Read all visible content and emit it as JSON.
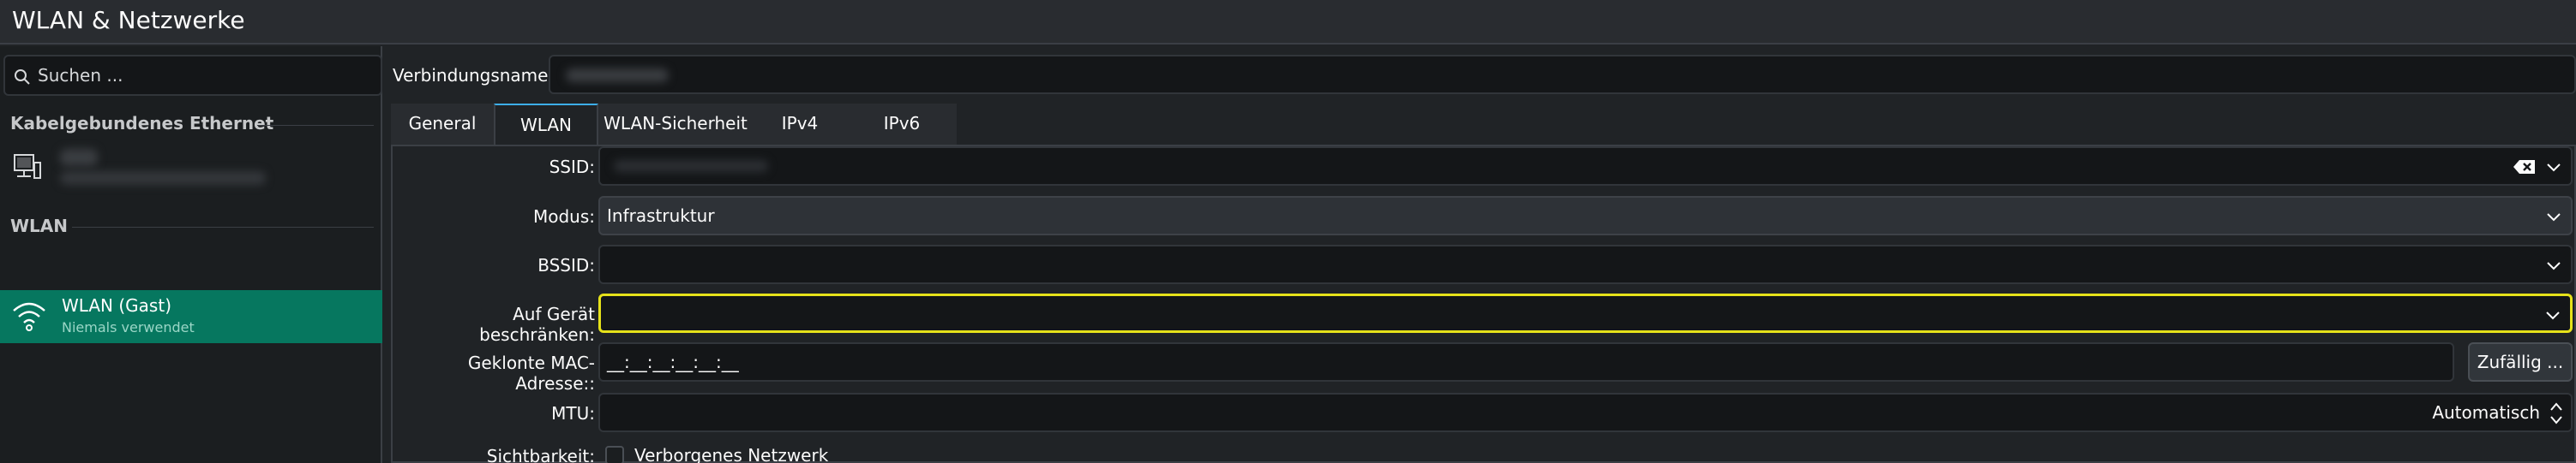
{
  "window": {
    "title": "WLAN & Netzwerke"
  },
  "sidebar": {
    "search_placeholder": "Suchen ...",
    "sections": [
      {
        "label": "Kabelgebundenes Ethernet"
      },
      {
        "label": "WLAN"
      }
    ],
    "wifi_item": {
      "name": "WLAN (Gast)",
      "status": "Niemals verwendet"
    }
  },
  "main": {
    "connection_name_label": "Verbindungsname:",
    "tabs": [
      {
        "label": "General"
      },
      {
        "label": "WLAN"
      },
      {
        "label": "WLAN-Sicherheit"
      },
      {
        "label": "IPv4"
      },
      {
        "label": "IPv6"
      }
    ],
    "form": {
      "ssid_label": "SSID:",
      "mode_label": "Modus:",
      "mode_value": "Infrastruktur",
      "bssid_label": "BSSID:",
      "device_label": "Auf Gerät beschränken:",
      "mac_label": "Geklonte MAC-Adresse::",
      "mac_value": "__:__:__:__:__:__",
      "random_button": "Zufällig ...",
      "mtu_label": "MTU:",
      "mtu_value": "Automatisch",
      "visibility_label": "Sichtbarkeit:",
      "hidden_network_label": "Verborgenes Netzwerk"
    }
  },
  "colors": {
    "accent": "#06775f",
    "focus": "#e6e21a",
    "tab_indicator": "#3daee9"
  }
}
